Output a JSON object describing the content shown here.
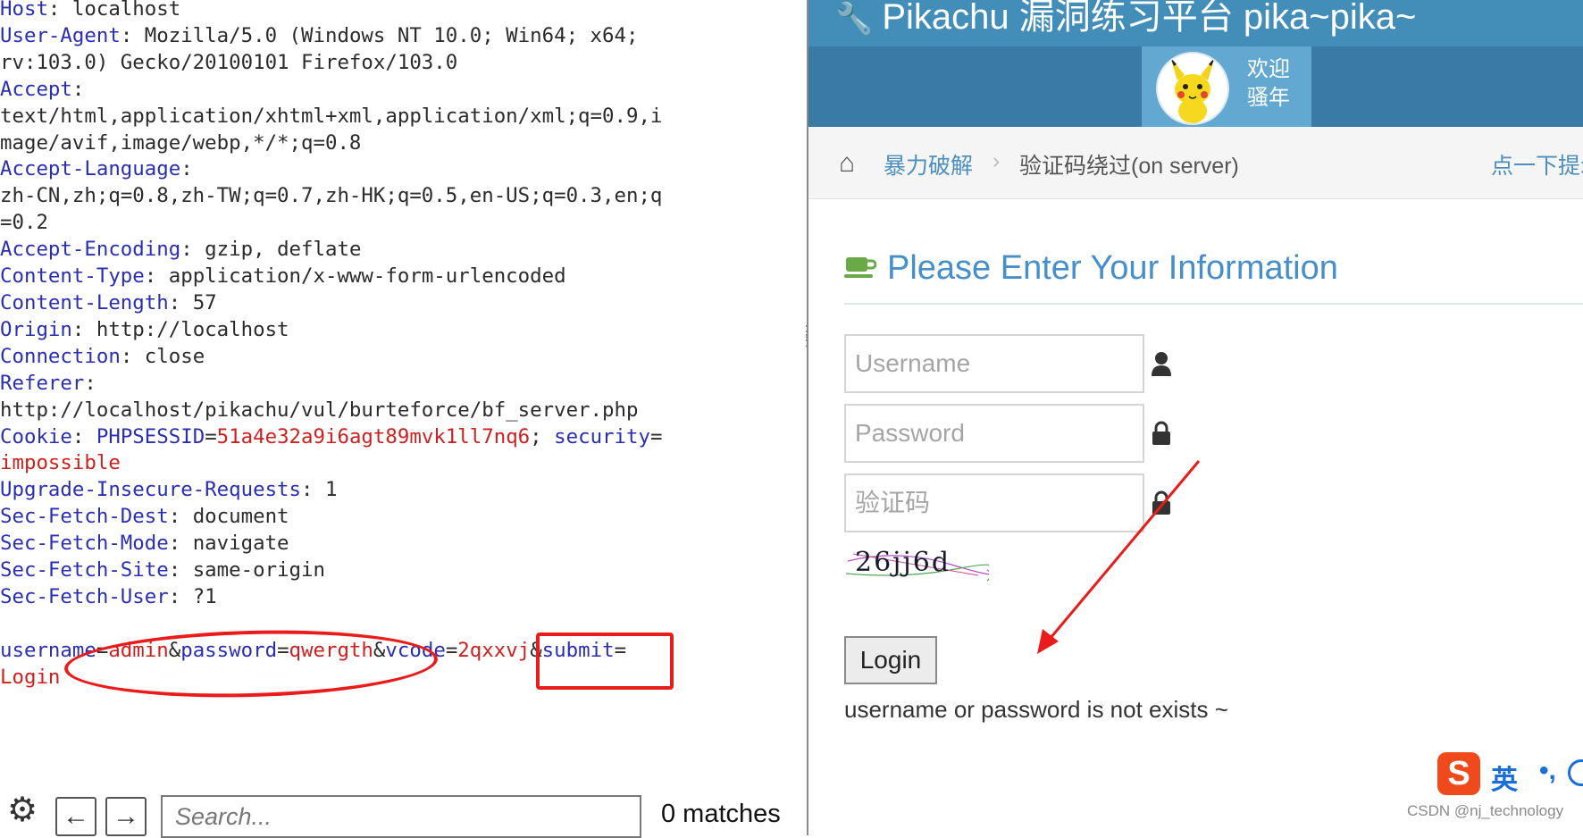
{
  "request": {
    "headers": [
      {
        "name": "Host",
        "value": "localhost"
      },
      {
        "name": "User-Agent",
        "value": "Mozilla/5.0 (Windows NT 10.0; Win64; x64;\nrv:103.0) Gecko/20100101 Firefox/103.0"
      },
      {
        "name": "Accept",
        "value": "\ntext/html,application/xhtml+xml,application/xml;q=0.9,i\nmage/avif,image/webp,*/*;q=0.8"
      },
      {
        "name": "Accept-Language",
        "value": "\nzh-CN,zh;q=0.8,zh-TW;q=0.7,zh-HK;q=0.5,en-US;q=0.3,en;q\n=0.2"
      },
      {
        "name": "Accept-Encoding",
        "value": "gzip, deflate"
      },
      {
        "name": "Content-Type",
        "value": "application/x-www-form-urlencoded"
      },
      {
        "name": "Content-Length",
        "value": "57"
      },
      {
        "name": "Origin",
        "value": "http://localhost"
      },
      {
        "name": "Connection",
        "value": "close"
      },
      {
        "name": "Referer",
        "value": "\nhttp://localhost/pikachu/vul/burteforce/bf_server.php"
      },
      {
        "name": "Cookie",
        "cookies": [
          {
            "k": "PHPSESSID",
            "v": "51a4e32a9i6agt89mvk1ll7nq6"
          },
          {
            "k": "security",
            "v": "impossible"
          }
        ]
      },
      {
        "name": "Upgrade-Insecure-Requests",
        "value": "1"
      },
      {
        "name": "Sec-Fetch-Dest",
        "value": "document"
      },
      {
        "name": "Sec-Fetch-Mode",
        "value": "navigate"
      },
      {
        "name": "Sec-Fetch-Site",
        "value": "same-origin"
      },
      {
        "name": "Sec-Fetch-User",
        "value": "?1"
      }
    ],
    "body": [
      {
        "k": "username",
        "v": "admin"
      },
      {
        "k": "password",
        "v": "qwergth"
      },
      {
        "k": "vcode",
        "v": "2qxxvj"
      },
      {
        "k": "submit",
        "v": "Login"
      }
    ]
  },
  "search": {
    "placeholder": "Search...",
    "matches": "0 matches"
  },
  "page": {
    "brand": "Pikachu 漏洞练习平台 pika~pika~",
    "welcome_line1": "欢迎",
    "welcome_line2": "骚年",
    "breadcrumb": {
      "parent": "暴力破解",
      "current": "验证码绕过(on server)",
      "hint": "点一下提示~"
    },
    "form": {
      "heading": "Please Enter Your Information",
      "username_placeholder": "Username",
      "password_placeholder": "Password",
      "vcode_placeholder": "验证码",
      "captcha_text": "26jj6d",
      "login_label": "Login",
      "message": "username or password is not exists ~"
    },
    "ime": {
      "logo": "S",
      "mode": "英",
      "punct": "•,"
    },
    "watermark": "CSDN @nj_technology"
  },
  "colors": {
    "annotation": "#ea1b1b",
    "header_blue": "#438eb9",
    "key_blue": "#2a2eb3",
    "value_red": "#cf1f1f"
  }
}
